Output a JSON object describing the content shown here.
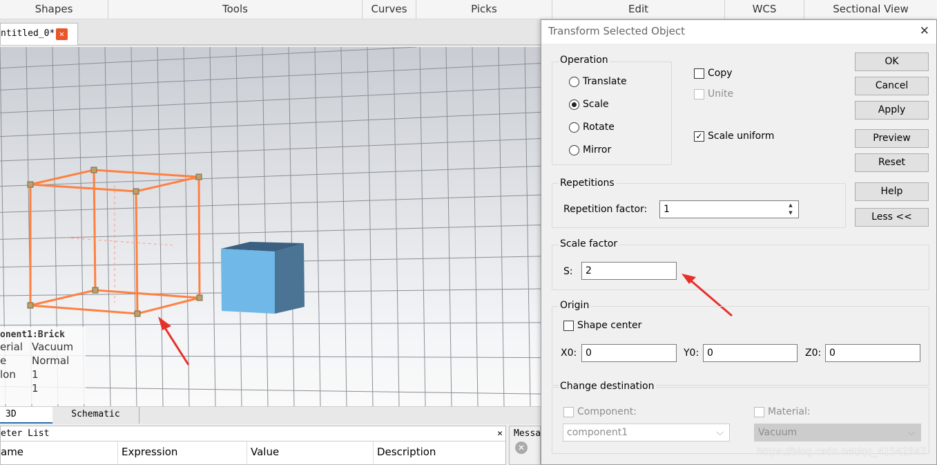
{
  "menubar": [
    "Shapes",
    "Tools",
    "Curves",
    "Picks",
    "Edit",
    "WCS",
    "Sectional View"
  ],
  "doc_tab": {
    "label": "ntitled_0*",
    "close": "✕"
  },
  "info": {
    "title": "onent1:Brick",
    "rows": [
      [
        "erial",
        "Vacuum"
      ],
      [
        "e",
        "Normal"
      ],
      [
        "lon",
        "1"
      ],
      [
        "",
        "1"
      ]
    ]
  },
  "view_tabs": [
    "3D",
    "Schematic"
  ],
  "param_list": {
    "title": "eter List",
    "close": "✕",
    "columns": [
      "ame",
      "Expression",
      "Value",
      "Description"
    ]
  },
  "messages": {
    "title": "Messa"
  },
  "dialog": {
    "title": "Transform Selected Object",
    "close": "✕",
    "operation": {
      "label": "Operation",
      "options": [
        "Translate",
        "Scale",
        "Rotate",
        "Mirror"
      ],
      "selected": "Scale"
    },
    "copy": {
      "label": "Copy",
      "checked": false
    },
    "unite": {
      "label": "Unite",
      "checked": false,
      "disabled": true
    },
    "scale_uniform": {
      "label": "Scale uniform",
      "checked": true
    },
    "buttons": [
      "OK",
      "Cancel",
      "Apply",
      "Preview",
      "Reset",
      "Help",
      "Less <<"
    ],
    "repetitions": {
      "label": "Repetitions",
      "factor_label": "Repetition factor:",
      "factor_value": "1"
    },
    "scale_factor": {
      "label": "Scale factor",
      "s_label": "S:",
      "s_value": "2"
    },
    "origin": {
      "label": "Origin",
      "shape_center": "Shape center",
      "shape_center_checked": false,
      "x0_label": "X0:",
      "x0": "0",
      "y0_label": "Y0:",
      "y0": "0",
      "z0_label": "Z0:",
      "z0": "0"
    },
    "change_destination": {
      "label": "Change destination",
      "component_label": "Component:",
      "component_value": "component1",
      "material_label": "Material:",
      "material_value": "Vacuum"
    }
  },
  "watermark": "https://blog.csdn.net/qq_41542947",
  "colors": {
    "selection": "#ff8040",
    "cube_front": "#6fb8e8",
    "cube_top": "#3a5f80",
    "cube_side": "#4a7394",
    "arrow": "#e8302a"
  }
}
